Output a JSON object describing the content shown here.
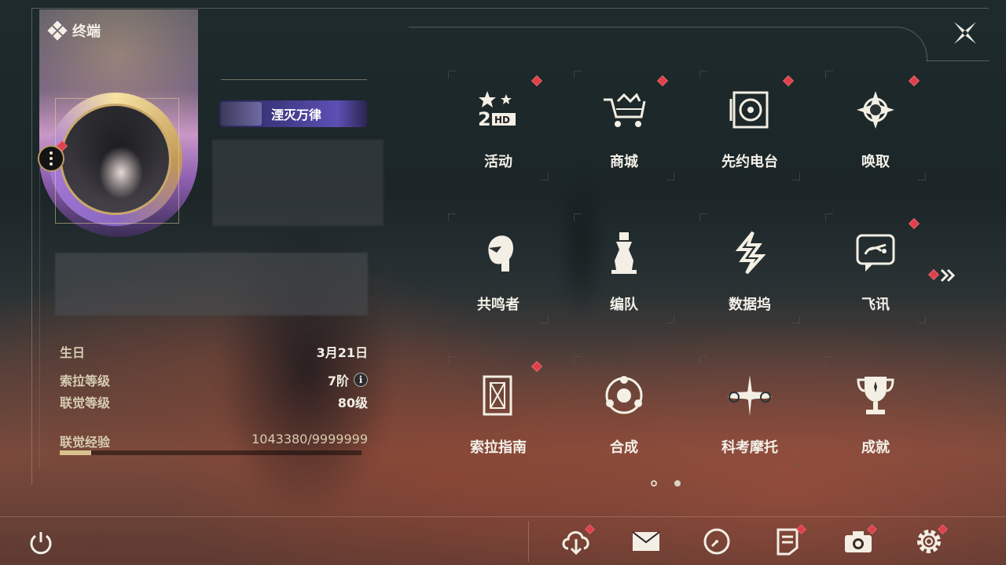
{
  "header": {
    "title": "终端"
  },
  "profile": {
    "badge_title": "湮灭万律"
  },
  "stats": [
    {
      "label": "生日",
      "value": "3月21日"
    },
    {
      "label": "索拉等级",
      "value": "7阶"
    },
    {
      "label": "联觉等级",
      "value": "80级"
    }
  ],
  "exp": {
    "label": "联觉经验",
    "value": "1043380/9999999",
    "progress": 0.104
  },
  "menu": {
    "tiles": [
      {
        "label": "活动",
        "icon": "event-2nd-anniversary-icon",
        "notify": true
      },
      {
        "label": "商城",
        "icon": "shop-cart-icon",
        "notify": true
      },
      {
        "label": "先约电台",
        "icon": "radio-record-icon",
        "notify": true
      },
      {
        "label": "唤取",
        "icon": "convene-compass-icon",
        "notify": true
      },
      {
        "label": "共鸣者",
        "icon": "resonator-head-icon",
        "notify": false
      },
      {
        "label": "编队",
        "icon": "team-chess-icon",
        "notify": false
      },
      {
        "label": "数据坞",
        "icon": "data-bank-icon",
        "notify": false
      },
      {
        "label": "飞讯",
        "icon": "chat-message-icon",
        "notify": true
      },
      {
        "label": "索拉指南",
        "icon": "guidebook-icon",
        "notify": true
      },
      {
        "label": "合成",
        "icon": "synthesis-icon",
        "notify": false
      },
      {
        "label": "科考摩托",
        "icon": "motorbike-icon",
        "notify": false
      },
      {
        "label": "成就",
        "icon": "trophy-icon",
        "notify": false
      }
    ]
  },
  "pagination": {
    "pages": 2,
    "current": 1
  },
  "bottom": {
    "icons": [
      {
        "name": "download-icon",
        "notify": true
      },
      {
        "name": "mail-icon",
        "notify": false
      },
      {
        "name": "clock-icon",
        "notify": false
      },
      {
        "name": "notice-icon",
        "notify": true
      },
      {
        "name": "camera-icon",
        "notify": true
      },
      {
        "name": "settings-gear-icon",
        "notify": true
      }
    ]
  },
  "colors": {
    "accent": "#d9c28e",
    "notify": "#e0404b",
    "text": "#f3f0e8"
  }
}
